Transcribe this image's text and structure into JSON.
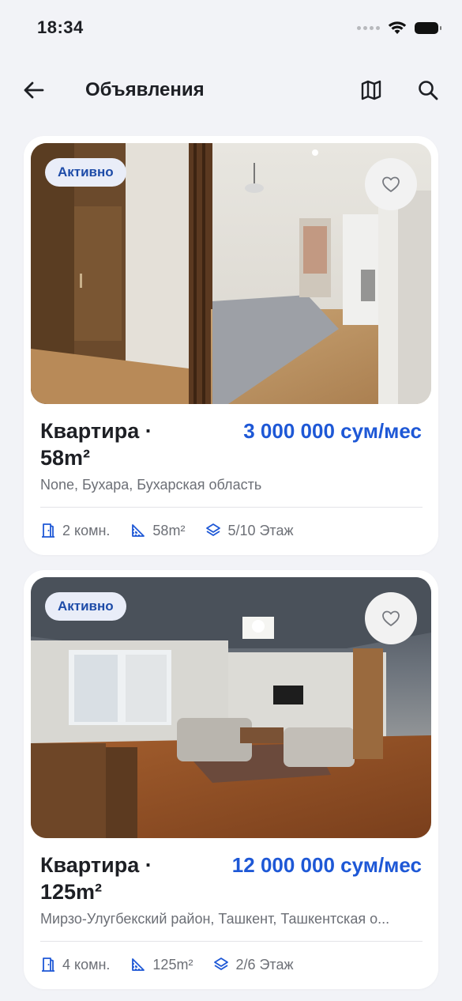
{
  "status_bar": {
    "time": "18:34"
  },
  "header": {
    "title": "Объявления"
  },
  "listings": [
    {
      "status": "Активно",
      "title": "Квартира · 58m²",
      "price": "3 000 000 сум/мес",
      "address": "None, Бухара, Бухарская область",
      "rooms": "2 комн.",
      "area": "58m²",
      "floor": "5/10 Этаж"
    },
    {
      "status": "Активно",
      "title": "Квартира · 125m²",
      "price": "12 000 000 сум/мес",
      "address": "Мирзо-Улугбекский район, Ташкент, Ташкентская о...",
      "rooms": "4 комн.",
      "area": "125m²",
      "floor": "2/6 Этаж"
    }
  ],
  "colors": {
    "accent": "#1e58d6",
    "badge_bg": "#e9edf8",
    "badge_text": "#1e4ca8",
    "background": "#f2f3f7"
  },
  "icons": [
    "back-arrow-icon",
    "map-icon",
    "search-icon",
    "heart-icon",
    "door-icon",
    "ruler-icon",
    "layers-icon",
    "wifi-icon",
    "battery-icon"
  ]
}
